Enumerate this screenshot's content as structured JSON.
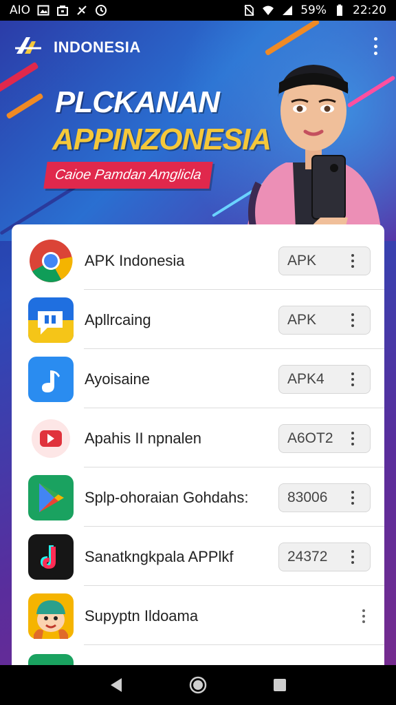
{
  "status_bar": {
    "carrier": "AIO",
    "battery": "59%",
    "time": "22:20",
    "icons_left": [
      "image-icon",
      "bag-icon",
      "nfc-icon",
      "alarm-icon"
    ],
    "icons_right": [
      "no-sim-icon",
      "wifi-icon",
      "signal-icon",
      "battery-icon"
    ]
  },
  "header": {
    "brand": "INDONESIA",
    "logo_icon": "brand-logo-icon",
    "menu_icon": "more-vert-icon"
  },
  "banner": {
    "headline_line1": "PLCKANAN",
    "headline_line2": "APPINZONESIA",
    "tagline": "Caioe Pamdan Amglicla"
  },
  "apps": [
    {
      "name": "APK Indonesia",
      "badge": "APK",
      "icon": "chrome-icon",
      "more_icon": "more-vert-icon"
    },
    {
      "name": "Apllrcaing",
      "badge": "APK",
      "icon": "chat-bubble-icon",
      "more_icon": "more-vert-icon"
    },
    {
      "name": "Ayoisaine",
      "badge": "APK4",
      "icon": "music-note-icon",
      "more_icon": "more-vert-icon"
    },
    {
      "name": "Apahis II npnalen",
      "badge": "A6OT2",
      "icon": "video-icon",
      "more_icon": "more-vert-icon"
    },
    {
      "name": "Splp-ohoraian Gohdahs:",
      "badge": "83006",
      "icon": "play-store-icon",
      "more_icon": "more-vert-icon"
    },
    {
      "name": "Sanatkngkpala APPlkf",
      "badge": "24372",
      "icon": "tiktok-icon",
      "more_icon": "more-vert-icon"
    },
    {
      "name": "Supyptn Ildoama",
      "badge": "",
      "icon": "cartoon-face-icon",
      "more_icon": "more-vert-icon"
    }
  ],
  "nav": {
    "back": "back-icon",
    "home": "home-icon",
    "recents": "recents-icon"
  },
  "colors": {
    "accent_yellow": "#f5c83a",
    "tagline_red": "#e0284c",
    "banner_blue": "#2a6fd1",
    "banner_purple": "#5b2aa0"
  }
}
